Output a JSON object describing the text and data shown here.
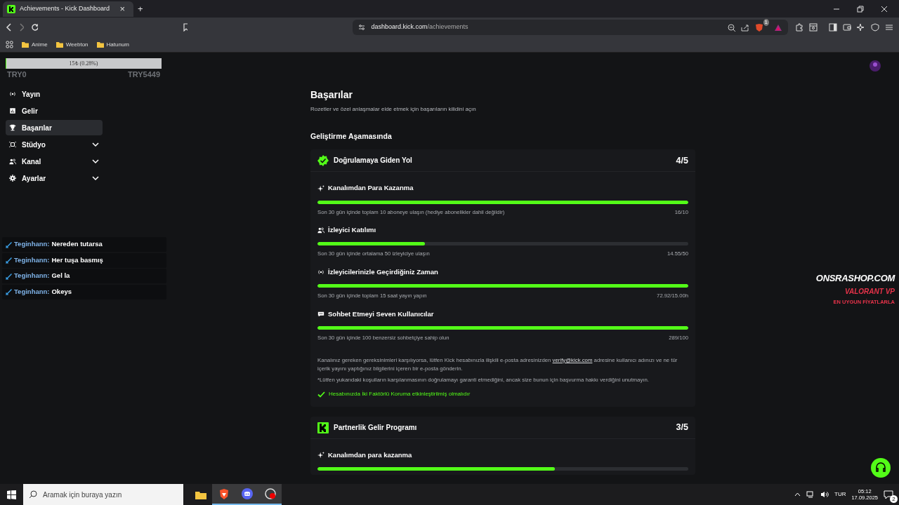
{
  "browser": {
    "tab_title": "Achievements - Kick Dashboard",
    "tab_close": "×",
    "new_tab": "+",
    "url_host": "dashboard.kick.com",
    "url_path": "/achievements",
    "extension_badge": "1",
    "bookmarks": [
      "Anime",
      "Weebton",
      "Hatunum"
    ]
  },
  "goal_overlay": {
    "label": "15₺ (0.28%)",
    "level": 0.0028,
    "min": "TRY0",
    "max": "TRY5449"
  },
  "sidebar": {
    "items": [
      {
        "label": "Yayın",
        "kind": "broadcast",
        "selected": false,
        "expandable": false
      },
      {
        "label": "Gelir",
        "kind": "chart",
        "selected": false,
        "expandable": false
      },
      {
        "label": "Başarılar",
        "kind": "trophy",
        "selected": true,
        "expandable": false
      },
      {
        "label": "Stüdyo",
        "kind": "studio",
        "selected": false,
        "expandable": true
      },
      {
        "label": "Kanal",
        "kind": "users",
        "selected": false,
        "expandable": true
      },
      {
        "label": "Ayarlar",
        "kind": "gear",
        "selected": false,
        "expandable": true
      }
    ]
  },
  "chat_overlay": [
    {
      "user": "Teginhann:",
      "message": "Nereden tutarsa"
    },
    {
      "user": "Teginhann:",
      "message": "Her tuşa basmış"
    },
    {
      "user": "Teginhann:",
      "message": "Gel la"
    },
    {
      "user": "Teginhann:",
      "message": "Okeys"
    }
  ],
  "page": {
    "title": "Başarılar",
    "subtitle": "Rozetler ve özel anlaşmalar elde etmek için başarıların kilidini açın",
    "section": "Geliştirme Aşamasında"
  },
  "achievements": [
    {
      "title": "Doğrulamaya Giden Yol",
      "kind": "verified",
      "progress": "4/5",
      "tasks": [
        {
          "kind": "sparkle",
          "title": "Kanalımdan Para Kazanma",
          "level": 1,
          "description": "Son 30 gün içinde toplam 10 aboneye ulaşın (hediye abonelikler dahil değildir)",
          "reading": "16/10"
        },
        {
          "kind": "users",
          "title": "İzleyici Katılımı",
          "level": 0.29,
          "description": "Son 30 gün içinde ortalama 50 izleyiciye ulaşın",
          "reading": "14.55/50"
        },
        {
          "kind": "broadcast",
          "title": "İzleyicilerinizle Geçirdiğiniz Zaman",
          "level": 1,
          "description": "Son 30 gün içinde toplam 15 saat yayın yapın",
          "reading": "72.92/15.00h"
        },
        {
          "kind": "chat",
          "title": "Sohbet Etmeyi Seven Kullanıcılar",
          "level": 1,
          "description": "Son 30 gün içinde 100 benzersiz sohbetçiye sahip olun",
          "reading": "289/100"
        }
      ],
      "note": {
        "before": "Kanalınız gereken gereksinimleri karşılıyorsa, lütfen Kick hesabınızla ilişkili e-posta adresinizden",
        "link": "verify@kick.com",
        "after": "adresine kullanıcı adınızı ve ne tür içerik yayını yaptığınız bilgilerini içeren bir e-posta gönderin."
      },
      "disclaimer": "*Lütfen yukarıdaki koşulların karşılanmasının doğrulamayı garanti etmediğini, ancak size bunun için başvurma hakkı verdiğini unutmayın.",
      "requirement": {
        "text": "Hesabınızda İki Faktörlü Koruma etkinleştirilmiş olmalıdır",
        "met": true
      }
    },
    {
      "title": "Partnerlik Gelir Programı",
      "kind": "kick",
      "progress": "3/5",
      "tasks": [
        {
          "kind": "sparkle",
          "title": "Kanalımdan para kazanma",
          "level": 0.64
        }
      ]
    }
  ],
  "shop_overlay": {
    "brand": "ONSRASHOP.COM",
    "line1": "VALORANT VP",
    "line2": "EN UYGUN FİYATLARLA"
  },
  "taskbar": {
    "search_placeholder": "Aramak için buraya yazın",
    "language": "TUR",
    "time": "05:12",
    "date": "17.09.2025",
    "notification_count": "2"
  }
}
